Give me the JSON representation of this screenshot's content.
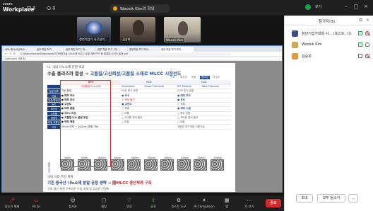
{
  "titlebar": {
    "brand_line1": "zoom",
    "brand_line2": "Workplace",
    "home_icon": "home-icon",
    "home_label": "홈",
    "paw_icon": "paw-icon",
    "paw_label": "홈",
    "meeting_title": "Woosik Kim의 회의",
    "view_label": "보기"
  },
  "videos": [
    {
      "name": "청년기업가 사무실의 ..."
    },
    {
      "name": "김승희"
    },
    {
      "name": "Woosik Kim"
    }
  ],
  "browser": {
    "tabs": [
      "HPS 중국/국산화(S...",
      "첨부 파일 보기",
      "첨부 파일 보기 - 파...",
      "첨부 파일 보기 - 파...",
      "첨부파일 보기 미리...",
      "첨부 파일 보기 미리..."
    ],
    "url": "C:/Users/woosik/Downloads/국가전략기술 나노소재 MLCC 분말 제조 PPT 중 발췌본_0709_발표.pdf",
    "bookmarks": "Lightroom 사용 팁"
  },
  "slide": {
    "kicker": "나. 국내 나노소재 분말 비교",
    "title_prefix": "수출 플라즈마 합성 ",
    "title_em": "→ 고품질/고신뢰성/고품질 소재로 MLCC 시장선도",
    "nav": [
      "목적",
      "필요성",
      "현황",
      "중요성",
      "국내외"
    ],
    "nav_active_index": 3,
    "columns": [
      "SPS",
      "PVD",
      "CVD"
    ],
    "subcolumns": [
      "국내유일 나노소재",
      "Sumitomo",
      "Shoei Chemical",
      "JFE Mineral",
      "Toho Titanium"
    ],
    "rows": [
      {
        "label": "분말 제조",
        "sps": "기상 합성",
        "pvd": "PVD 방식 공정",
        "cvd": "CVD 방식 공정"
      },
      {
        "label": "균일",
        "sps": "● 매우 우수",
        "pvd": "● 우수",
        "cvd": "● 매우 우수"
      },
      {
        "label": "입경/결정성",
        "sps": "● 매우 우수",
        "pvd": "✕ 제어 불가",
        "cvd": "● 우수"
      },
      {
        "label": "순도",
        "sps": "● 고순도",
        "pvd": "● 고순도",
        "cvd": "○ 보통"
      },
      {
        "label": "생산성",
        "sps": "● 매우 좋음",
        "pvd": "○ 보통",
        "cvd": "● 매우 느림"
      },
      {
        "label": "수득률",
        "sps": "● 90% 이상",
        "pvd": "△ 보통",
        "cvd": "△ 매우 낮음"
      },
      {
        "label": "경쟁성",
        "sps": "● 고품질 나노 분말 양산",
        "pvd": "△ 고비용 장비 필요",
        "cvd": "△ 고비용 장비 필요"
      },
      {
        "label": "비용 적합성",
        "sps": "● 매우 적합",
        "pvd": "△ 보통",
        "cvd": "△ 보통"
      },
      {
        "label": "기타",
        "sps": "20nm 이하 ~ 수십 nm 범위 가능",
        "pvd": "",
        "cvd": "제한된 연구개발 사용가능"
      }
    ],
    "sem_labels": [
      "50nm",
      "50nm",
      "100nm",
      "80nm",
      "150nm",
      "300nm",
      "100nm",
      "100nm",
      "150nm",
      "200nm"
    ],
    "sem_row_label": "제품 사진",
    "foot_kicker": "국내 사업 추진 계획",
    "foot_title_prefix": "기존 중국산 나노소재 분말 공정 생략 → ",
    "foot_title_em": "國MLCC 생산체계 구축",
    "foot_sub": "국내 생산 체계 구축으로 수입 대체 및 공급망 안정화"
  },
  "participants": {
    "title": "참가자(3)",
    "list": [
      {
        "name": "청년기업가대회 사... (호스트, 나)",
        "avatar_color": "#3b4f8f",
        "mic_muted": true,
        "cam_on": true
      },
      {
        "name": "Woosik Kim",
        "avatar_color": "#d4a64a",
        "mic_muted": false,
        "cam_on": true
      },
      {
        "name": "김승희",
        "avatar_color": "#e59a2a",
        "mic_muted": true,
        "cam_on": false
      }
    ],
    "invite_label": "초대",
    "mute_all_label": "모두 음소거"
  },
  "toolbar": {
    "items": [
      {
        "icon": "mic-icon",
        "label": "음소거 해제"
      },
      {
        "icon": "video-icon",
        "label": "비디오"
      },
      {
        "icon": "participants-icon",
        "label": "참가자"
      },
      {
        "icon": "chat-icon",
        "label": "채팅"
      },
      {
        "icon": "reactions-icon",
        "label": "반응"
      },
      {
        "icon": "share-icon",
        "label": "공유"
      },
      {
        "icon": "host-tools-icon",
        "label": "호스트 도구"
      },
      {
        "icon": "ai-icon",
        "label": "AI Companion"
      },
      {
        "icon": "apps-icon",
        "label": "앱"
      },
      {
        "icon": "more-icon",
        "label": "더 보기"
      }
    ],
    "end_label": "종료"
  }
}
